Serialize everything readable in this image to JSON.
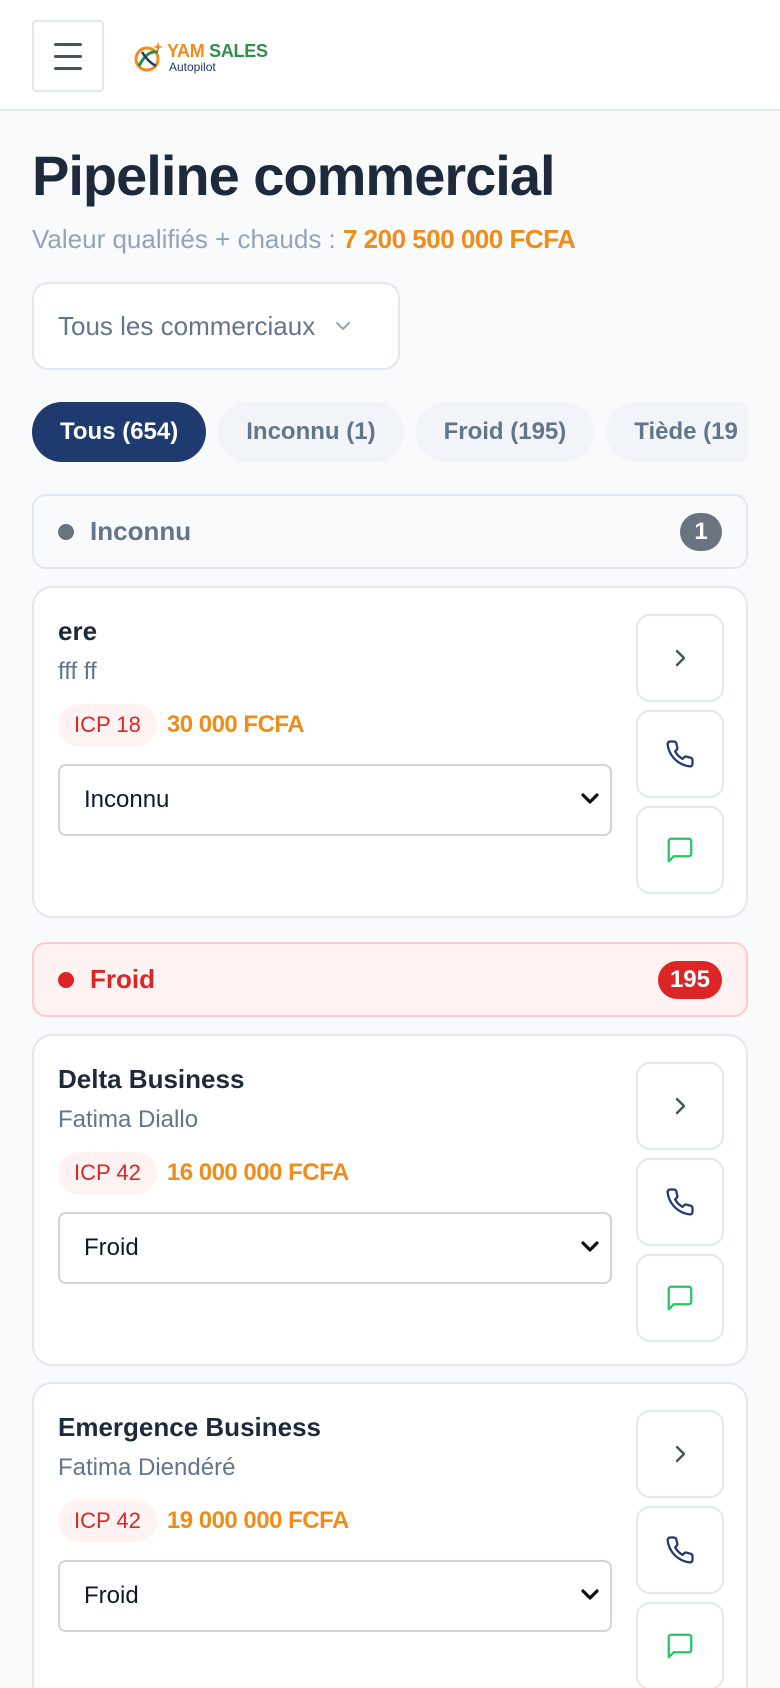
{
  "header": {
    "menu_icon": "hamburger-icon",
    "logo": {
      "word1": "YAM",
      "word2": "SALES",
      "sub": "Autopilot"
    }
  },
  "page": {
    "title": "Pipeline commercial",
    "subtitle_label": "Valeur qualifiés + chauds :",
    "subtitle_amount": "7 200 500 000 FCFA"
  },
  "filter": {
    "selected": "Tous les commerciaux"
  },
  "tabs": [
    {
      "label": "Tous (654)",
      "active": true
    },
    {
      "label": "Inconnu (1)",
      "active": false
    },
    {
      "label": "Froid (195)",
      "active": false
    },
    {
      "label": "Tiède (19",
      "active": false
    }
  ],
  "sections": {
    "unknown": {
      "label": "Inconnu",
      "count": "1",
      "color": "#6b7280"
    },
    "cold": {
      "label": "Froid",
      "count": "195",
      "color": "#dc2626"
    }
  },
  "cards": [
    {
      "name": "ere",
      "contact": "fff ff",
      "icp": "ICP 18",
      "value": "30 000 FCFA",
      "stage": "Inconnu"
    },
    {
      "name": "Delta Business",
      "contact": "Fatima Diallo",
      "icp": "ICP 42",
      "value": "16 000 000 FCFA",
      "stage": "Froid"
    },
    {
      "name": "Emergence Business",
      "contact": "Fatima Diendéré",
      "icp": "ICP 42",
      "value": "19 000 000 FCFA",
      "stage": "Froid"
    }
  ],
  "card_actions": [
    "chevron-right-icon",
    "phone-icon",
    "message-icon"
  ],
  "colors": {
    "primary": "#1e3a6e",
    "accent": "#f28c18",
    "danger": "#dc2626",
    "success": "#22c55e"
  }
}
